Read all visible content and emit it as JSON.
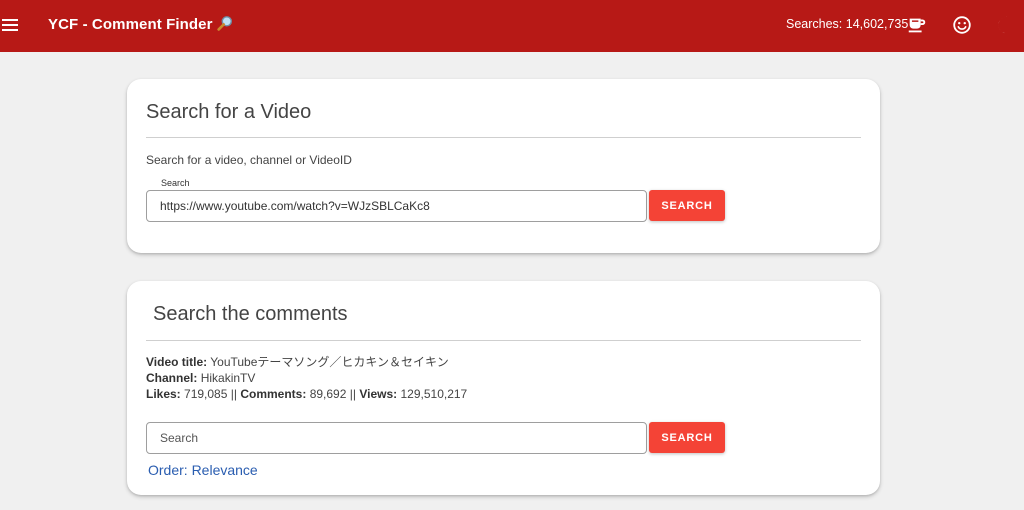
{
  "appbar": {
    "title": "YCF - Comment Finder",
    "searches_label": "Searches: 14,602,735",
    "icons": [
      "menu-icon",
      "magnifier-icon",
      "coffee-icon",
      "smile-icon",
      "moon-icon"
    ]
  },
  "video_search": {
    "title": "Search for a Video",
    "hint": "Search for a video, channel or VideoID",
    "field_label": "Search",
    "field_value": "https://www.youtube.com/watch?v=WJzSBLCaKc8",
    "button_label": "SEARCH"
  },
  "comment_search": {
    "title": "Search the comments",
    "video_title_label": "Video title:",
    "video_title_value": "YouTubeテーマソング／ヒカキン＆セイキン",
    "channel_label": "Channel:",
    "channel_value": "HikakinTV",
    "likes_label": "Likes:",
    "likes_value": "719,085",
    "comments_label": "Comments:",
    "comments_value": "89,692",
    "views_label": "Views:",
    "views_value": "129,510,217",
    "separator": "||",
    "field_placeholder": "Search",
    "button_label": "SEARCH",
    "order_label": "Order: Relevance"
  },
  "colors": {
    "appbar": "#b71916",
    "button": "#f44336",
    "link": "#2a5db0",
    "background": "#f0f0f0"
  }
}
